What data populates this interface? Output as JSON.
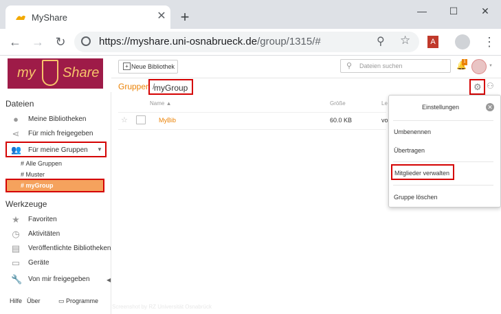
{
  "browser": {
    "tab_title": "MyShare",
    "url_host": "https://myshare.uni-osnabrueck.de",
    "url_path": "/group/1315/#",
    "new_tab_label": "+"
  },
  "logo": {
    "left": "my",
    "right": "Share"
  },
  "sidebar": {
    "section_files": "Dateien",
    "items": [
      {
        "label": "Meine Bibliotheken",
        "icon": "user-icon"
      },
      {
        "label": "Für mich freigegeben",
        "icon": "share-icon"
      },
      {
        "label": "Für meine Gruppen",
        "icon": "group-icon"
      }
    ],
    "groups": [
      {
        "label": "Alle Gruppen"
      },
      {
        "label": "Muster"
      },
      {
        "label": "myGroup"
      }
    ],
    "section_tools": "Werkzeuge",
    "tools": [
      {
        "label": "Favoriten",
        "icon": "star-icon"
      },
      {
        "label": "Aktivitäten",
        "icon": "history-icon"
      },
      {
        "label": "Veröffentlichte Bibliotheken",
        "icon": "library-icon"
      },
      {
        "label": "Geräte",
        "icon": "monitor-icon"
      },
      {
        "label": "Von mir freigegeben",
        "icon": "wrench-icon"
      }
    ],
    "footer": {
      "help": "Hilfe",
      "about": "Über",
      "programs": "Programme"
    }
  },
  "toolbar": {
    "new_library": "Neue Bibliothek",
    "search_placeholder": "Dateien suchen",
    "notification_count": "1"
  },
  "breadcrumb": {
    "parent": "Gruppen",
    "separator": "/",
    "current": "myGroup"
  },
  "table": {
    "headers": {
      "name": "Name",
      "size": "Größe",
      "last": "Le"
    },
    "rows": [
      {
        "name": "MyBib",
        "size": "60.0 KB",
        "last": "vo"
      }
    ]
  },
  "settings_popover": {
    "title": "Einstellungen",
    "items": [
      "Umbenennen",
      "Übertragen",
      "Mitglieder verwalten",
      "Gruppe löschen"
    ]
  },
  "watermark": "Screenshot by RZ Universität Osnabrück",
  "colors": {
    "brand": "#9e1b48",
    "accent": "#eb8205",
    "active": "#f5a25d",
    "highlight": "#d40000"
  }
}
